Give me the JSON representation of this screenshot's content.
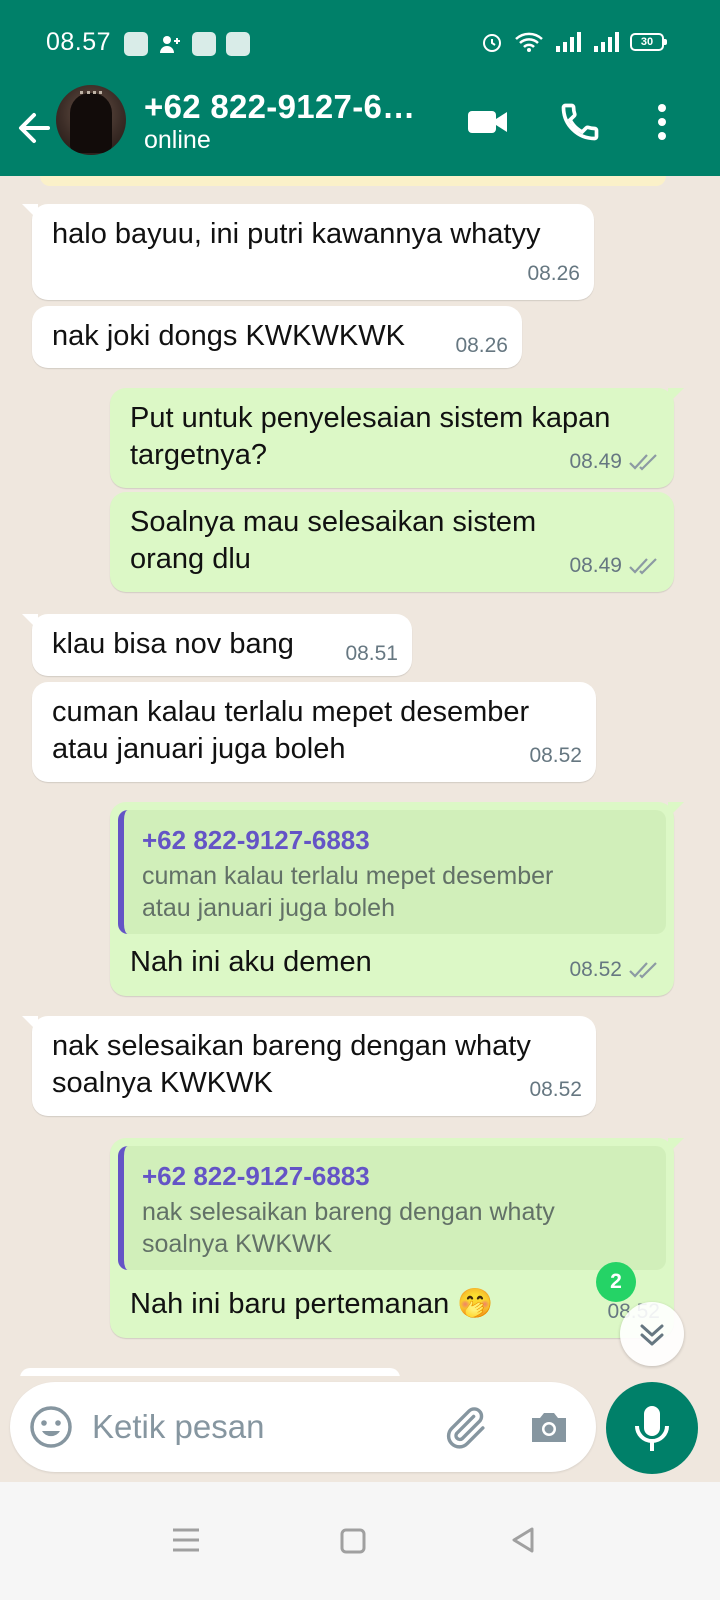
{
  "status_bar": {
    "time": "08.57",
    "battery": "30"
  },
  "header": {
    "contact_name": "+62 822-9127-6…",
    "status": "online"
  },
  "messages": [
    {
      "dir": "in",
      "lines": [
        "halo bayuu, ini putri kawannya whatyy"
      ],
      "time": "08.26"
    },
    {
      "dir": "in",
      "lines": [
        "nak joki dongs KWKWKWK"
      ],
      "time": "08.26"
    },
    {
      "dir": "out",
      "lines": [
        "Put untuk penyelesaian sistem kapan",
        "targetnya?"
      ],
      "time": "08.49"
    },
    {
      "dir": "out",
      "lines": [
        "Soalnya mau selesaikan sistem",
        "orang dlu"
      ],
      "time": "08.49"
    },
    {
      "dir": "in",
      "lines": [
        "klau bisa nov bang"
      ],
      "time": "08.51"
    },
    {
      "dir": "in",
      "lines": [
        "cuman kalau terlalu mepet desember",
        "atau januari juga boleh"
      ],
      "time": "08.52"
    },
    {
      "dir": "out",
      "quote_author": "+62 822-9127-6883",
      "quote_text": "cuman kalau terlalu mepet desember\natau januari juga boleh",
      "lines": [
        "Nah ini aku demen"
      ],
      "time": "08.52"
    },
    {
      "dir": "in",
      "lines": [
        "nak selesaikan bareng dengan whaty",
        "soalnya KWKWK"
      ],
      "time": "08.52"
    },
    {
      "dir": "out",
      "quote_author": "+62 822-9127-6883",
      "quote_text": "nak selesaikan bareng dengan whaty\nsoalnya KWKWK",
      "lines": [
        "Nah ini baru pertemanan 🤭"
      ],
      "time": "08.52"
    }
  ],
  "unread_count": "2",
  "composer": {
    "placeholder": "Ketik pesan"
  },
  "colors": {
    "primary": "#008069",
    "outgoing_bubble": "#dcf8c6",
    "incoming_bubble": "#ffffff",
    "read_ticks": "#8c9aa3",
    "quote_accent": "#5e4cc7"
  },
  "icons": [
    "back-arrow-icon",
    "video-call-icon",
    "voice-call-icon",
    "more-options-icon",
    "emoji-icon",
    "attach-icon",
    "camera-icon",
    "mic-icon",
    "scroll-down-icon",
    "double-check-icon"
  ]
}
